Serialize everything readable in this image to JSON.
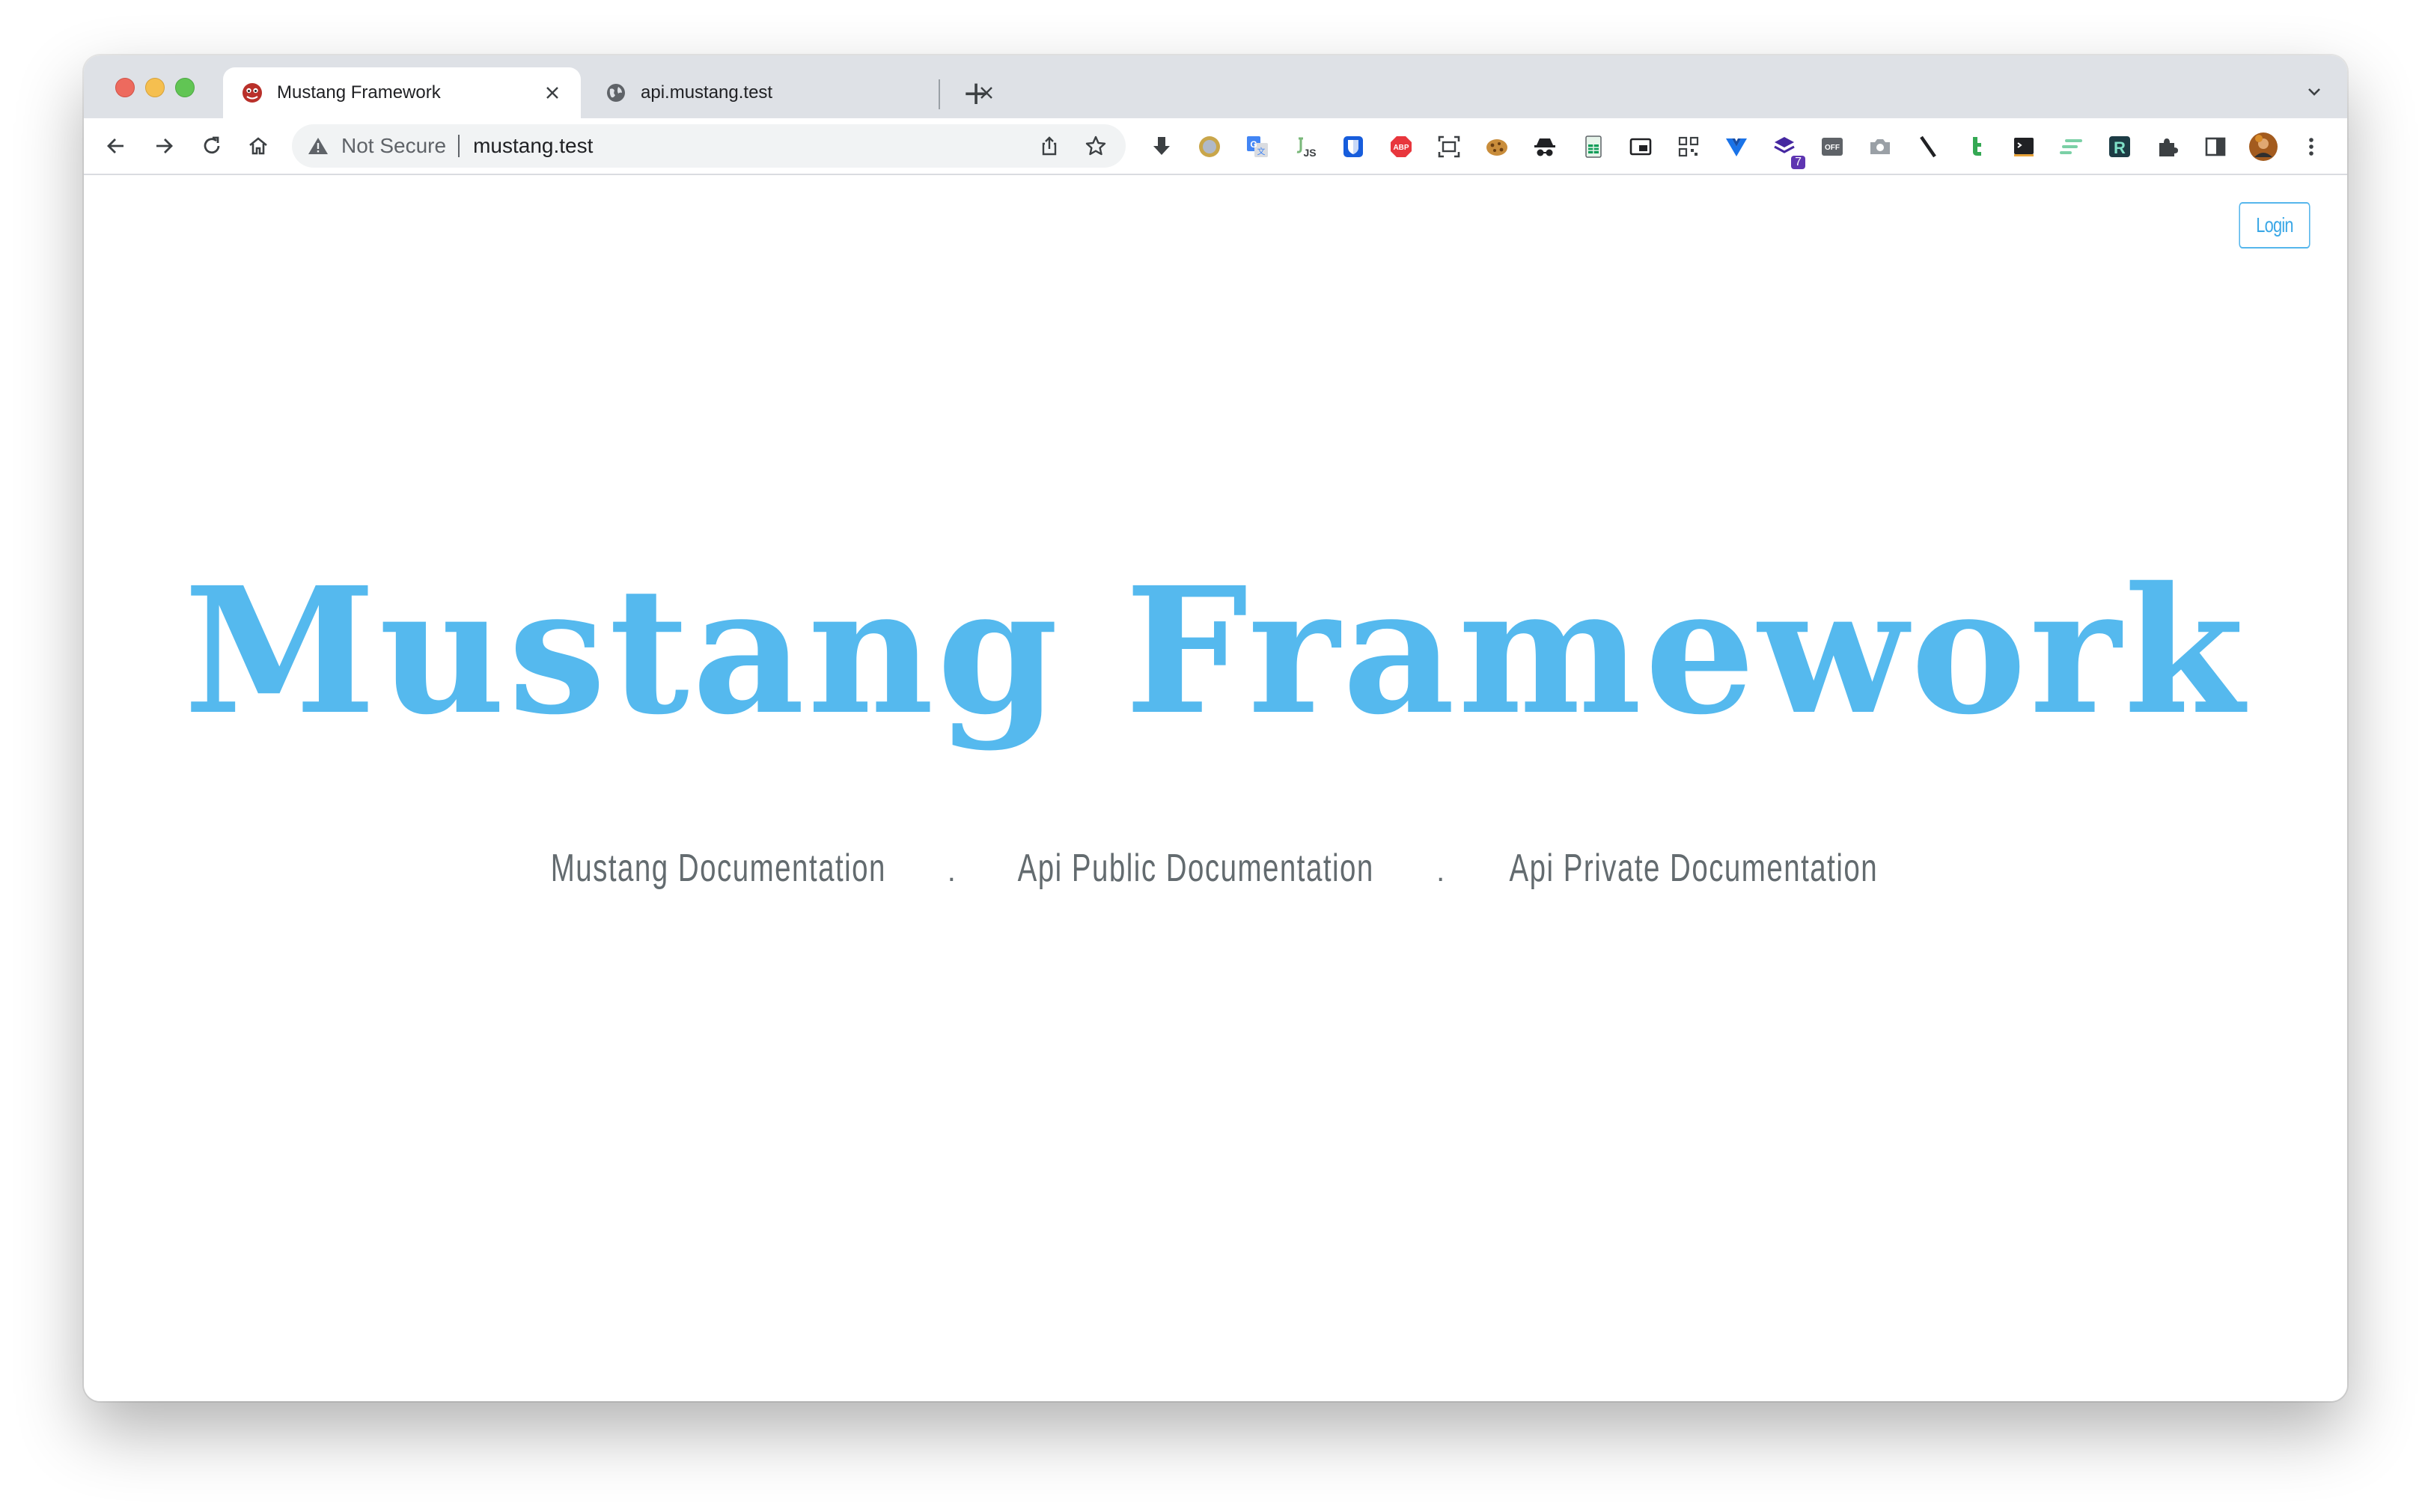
{
  "browser": {
    "tabs": [
      {
        "title": "Mustang Framework",
        "favicon": "mustang-logo-icon",
        "active": true
      },
      {
        "title": "api.mustang.test",
        "favicon": "globe-icon",
        "active": false
      }
    ],
    "new_tab_label": "+",
    "omnibox": {
      "security_label": "Not Secure",
      "url": "mustang.test"
    },
    "extensions": [
      "download-icon",
      "circle-icon",
      "translate-icon",
      "js-icon",
      "bitwarden-icon",
      "adblock-icon",
      "screenshot-icon",
      "cookie-icon",
      "incognito-icon",
      "sheets-icon",
      "pip-icon",
      "qr-code-icon",
      "vue-icon",
      "layers-icon",
      "off-icon",
      "camera-icon",
      "slash-icon",
      "tweetdeck-icon",
      "terminal-icon",
      "stripes-icon",
      "r-icon",
      "puzzle-icon",
      "sidebar-icon",
      "profile-avatar",
      "menu-dots-icon"
    ],
    "extension_badge": "7",
    "off_label": "OFF",
    "abp_label": "ABP"
  },
  "page": {
    "login_label": "Login",
    "hero_title": "Mustang Framework",
    "links": [
      "Mustang Documentation",
      "Api Public Documentation",
      "Api Private Documentation"
    ],
    "separator": "."
  },
  "colors": {
    "accent": "#55b9ee",
    "link_text": "#636b6f",
    "tabstrip": "#dee1e6"
  }
}
